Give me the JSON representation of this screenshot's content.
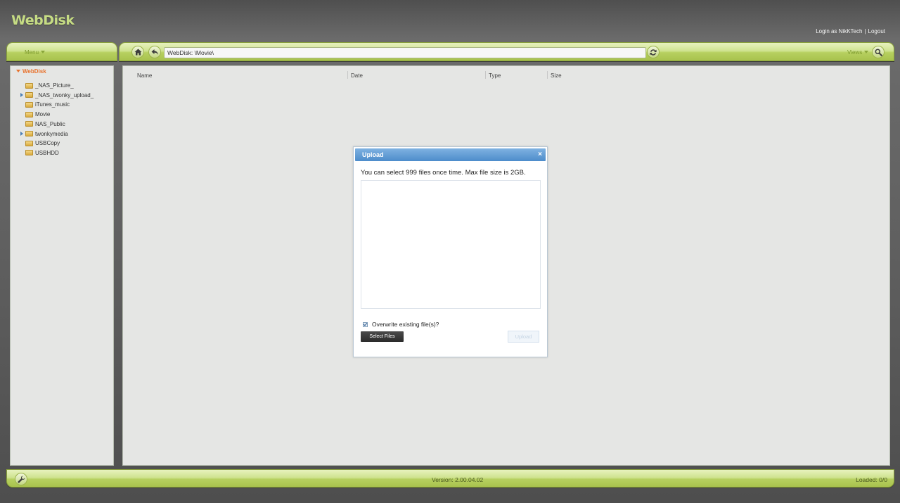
{
  "app": {
    "title": "WebDisk",
    "user_text": "Login as NikKTech",
    "separator": "|",
    "logout_label": "Logout"
  },
  "menubar": {
    "menu_label": "Menu"
  },
  "toolbar": {
    "path_value": "WebDisk: \\Movie\\",
    "views_label": "Views"
  },
  "tree": {
    "root_label": "WebDisk",
    "items": [
      {
        "label": "_NAS_Picture_",
        "expandable": false
      },
      {
        "label": "_NAS_twonky_upload_",
        "expandable": true
      },
      {
        "label": "iTunes_music",
        "expandable": false
      },
      {
        "label": "Movie",
        "expandable": false
      },
      {
        "label": "NAS_Public",
        "expandable": false
      },
      {
        "label": "twonkymedia",
        "expandable": true
      },
      {
        "label": "USBCopy",
        "expandable": false
      },
      {
        "label": "USBHDD",
        "expandable": false
      }
    ]
  },
  "filelist": {
    "columns": [
      "Name",
      "Date",
      "Type",
      "Size"
    ]
  },
  "dialog": {
    "title": "Upload",
    "close_label": "×",
    "message": "You can select 999 files once time. Max file size is 2GB.",
    "overwrite_label": "Overwrite existing file(s)?",
    "overwrite_checked": true,
    "select_label": "Select Files",
    "upload_label": "Upload"
  },
  "footer": {
    "version": "Version: 2.00.04.02",
    "loaded": "Loaded: 0/0"
  },
  "icons": {
    "home": "home-icon",
    "back": "back-arrow-icon",
    "refresh": "refresh-icon",
    "search": "search-icon",
    "wrench": "wrench-icon",
    "folder": "folder-icon"
  },
  "colors": {
    "accent_green": "#b7d060",
    "logo": "#c6dc84",
    "root_orange": "#e8732e",
    "dialog_title": "#4d8ccb"
  }
}
